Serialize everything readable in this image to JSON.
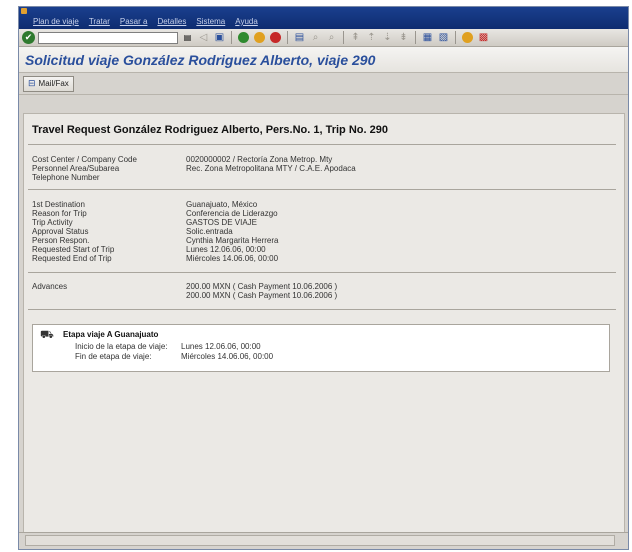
{
  "menu": [
    "Plan de viaje",
    "Tratar",
    "Pasar a",
    "Detalles",
    "Sistema",
    "Ayuda"
  ],
  "title": "Solicitud viaje González Rodriguez Alberto, viaje 290",
  "app_toolbar": {
    "mail_fax_label": "Mail/Fax"
  },
  "heading": "Travel Request González Rodriguez Alberto, Pers.No. 1, Trip No. 290",
  "org": {
    "cost_center_label": "Cost Center / Company Code",
    "cost_center_value": "0020000002 / Rectoría Zona Metrop. Mty",
    "personnel_area_label": "Personnel Area/Subarea",
    "personnel_area_value": "Rec. Zona Metropolitana MTY / C.A.E. Apodaca",
    "telephone_label": "Telephone Number"
  },
  "trip": {
    "destination_label": "1st Destination",
    "destination_value": "Guanajuato, México",
    "reason_label": "Reason for Trip",
    "reason_value": "Conferencia de Liderazgo",
    "activity_label": "Trip Activity",
    "activity_value": "GASTOS DE VIAJE",
    "approval_label": "Approval Status",
    "approval_value": "Solic.entrada",
    "responsible_label": "Person Respon.",
    "responsible_value": "Cynthia Margarita Herrera",
    "start_label": "Requested Start of Trip",
    "start_value": "Lunes 12.06.06, 00:00",
    "end_label": "Requested End of Trip",
    "end_value": "Miércoles 14.06.06, 00:00"
  },
  "advances": {
    "label": "Advances",
    "values": [
      "200.00 MXN ( Cash Payment 10.06.2006 )",
      "200.00 MXN ( Cash Payment 10.06.2006 )"
    ]
  },
  "stage": {
    "title": "Etapa viaje A Guanajuato",
    "start_label": "Inicio de la etapa de viaje:",
    "start_value": "Lunes 12.06.06, 00:00",
    "end_label": "Fin de etapa de viaje:",
    "end_value": "Miércoles 14.06.06, 00:00"
  }
}
